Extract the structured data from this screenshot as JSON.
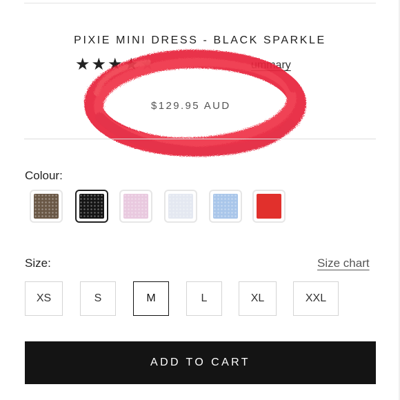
{
  "product": {
    "title": "PIXIE MINI DRESS - BLACK SPARKLE",
    "price": "$129.95 AUD",
    "review_link": "Review Summary",
    "review_link_visible": "ummary",
    "rating": 4,
    "rating_max": 5
  },
  "colour": {
    "label": "Colour:",
    "selected_index": 1,
    "swatches": [
      {
        "name": "brown-sparkle",
        "color": "#6a5846"
      },
      {
        "name": "black-sparkle",
        "color": "#151515"
      },
      {
        "name": "pink-sparkle",
        "color": "#e9c9df"
      },
      {
        "name": "white-sparkle",
        "color": "#e4e8f1"
      },
      {
        "name": "blue-sparkle",
        "color": "#a9c6ea"
      },
      {
        "name": "red",
        "color": "#e1302c"
      }
    ]
  },
  "size": {
    "label": "Size:",
    "chart_link": "Size chart",
    "selected": "M",
    "options": [
      "XS",
      "S",
      "M",
      "L",
      "XL",
      "XXL"
    ]
  },
  "cart": {
    "button_label": "ADD TO CART"
  },
  "colors": {
    "scribble": "#e8223a",
    "button_bg": "#141414"
  }
}
